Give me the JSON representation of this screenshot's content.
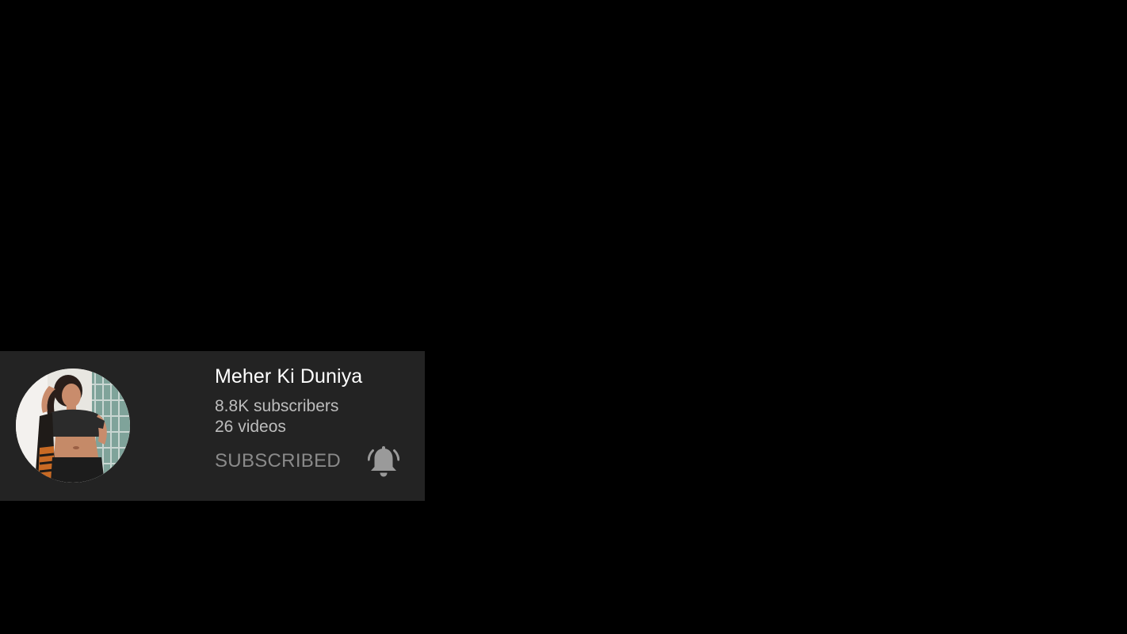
{
  "channel_card": {
    "avatar_icon": "channel-avatar-photo",
    "name": "Meher Ki Duniya",
    "subscribers": "8.8K subscribers",
    "videos": "26 videos",
    "subscribe_label": "SUBSCRIBED",
    "bell_icon": "notification-bell-ringing-icon"
  },
  "colors": {
    "background": "#000000",
    "card": "#232323",
    "name_text": "#ffffff",
    "meta_text": "#bdbdbd",
    "subscribed_text": "#8a8a8a",
    "bell": "#9a9a9a"
  }
}
